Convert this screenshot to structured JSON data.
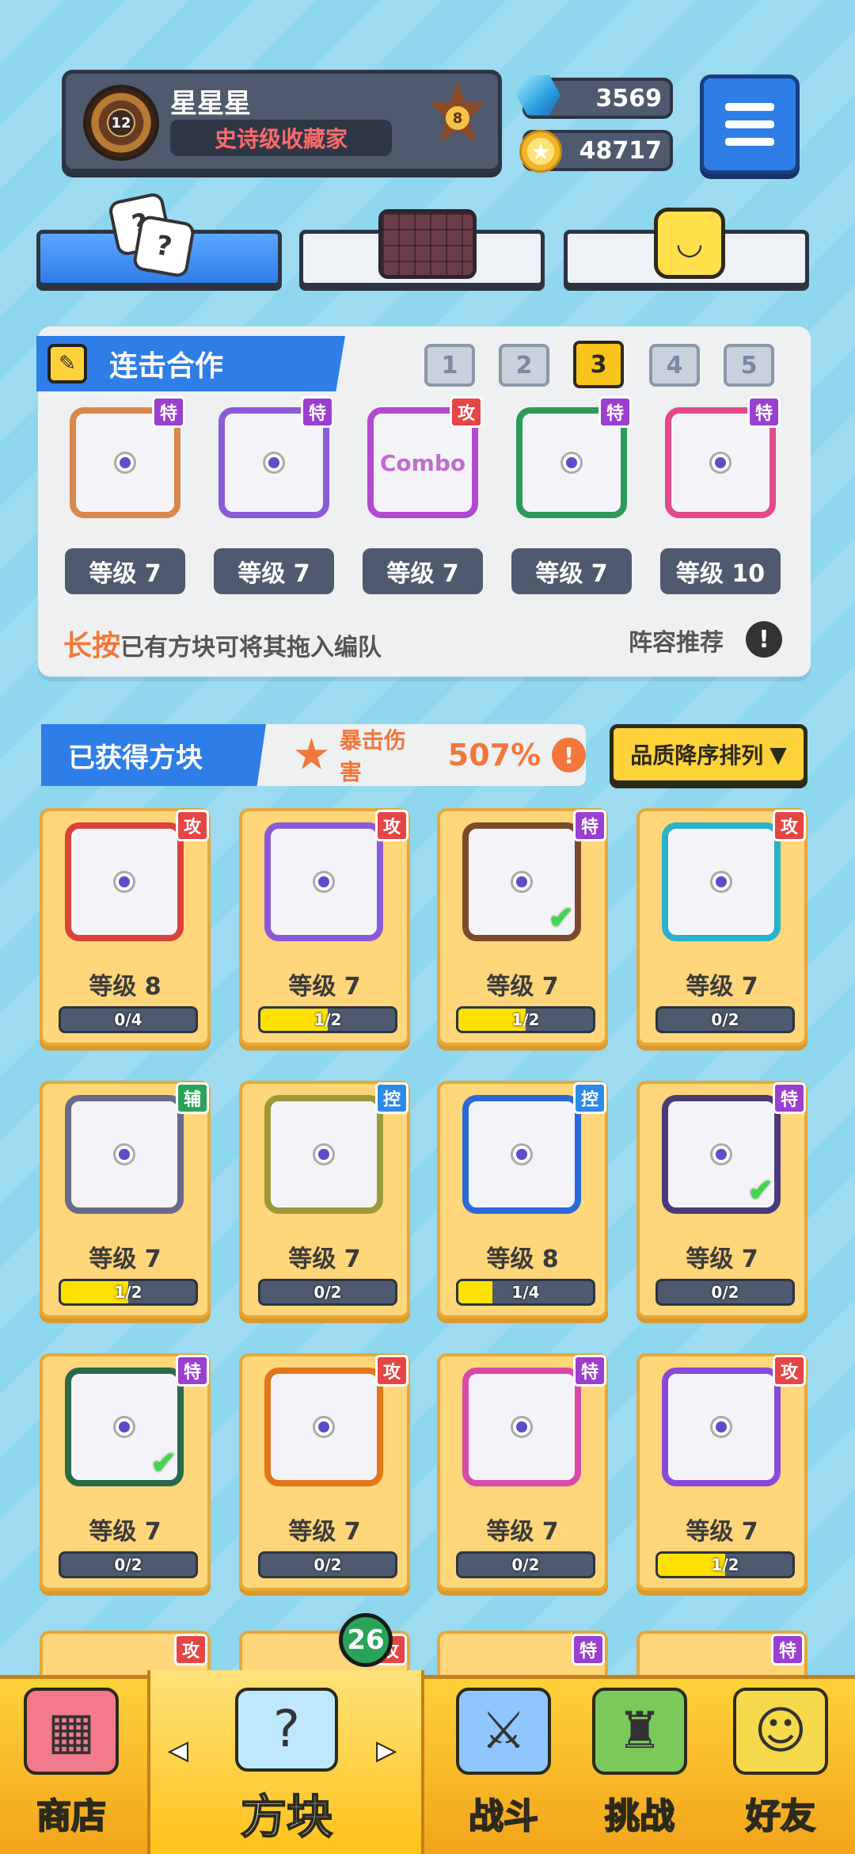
{
  "profile": {
    "name": "星星星",
    "title": "史诗级收藏家",
    "level": "12",
    "rank": "8"
  },
  "currency": {
    "gems": "3569",
    "coins": "48717"
  },
  "combo": {
    "title": "连击合作",
    "slots": [
      "1",
      "2",
      "3",
      "4",
      "5"
    ],
    "active_slot": "3",
    "blocks": [
      {
        "tag": "特",
        "level": "等级 7",
        "color": "#d9884a"
      },
      {
        "tag": "特",
        "level": "等级 7",
        "color": "#8a5ad8"
      },
      {
        "tag": "攻",
        "level": "等级 7",
        "color": "#b24ad0",
        "text": "Combo"
      },
      {
        "tag": "特",
        "level": "等级 7",
        "color": "#2c9a5a"
      },
      {
        "tag": "特",
        "level": "等级 10",
        "color": "#e24a8a"
      }
    ],
    "hint_highlight": "长按",
    "hint_text": "已有方块可将其拖入编队",
    "recommend": "阵容推荐",
    "recommend_icon": "!"
  },
  "owned": {
    "title": "已获得方块",
    "crit_label": "暴击伤害",
    "crit_value": "507%",
    "crit_icon": "!",
    "sort_label": "品质降序排列",
    "sort_arrow": "▼",
    "cards": [
      {
        "tag": "攻",
        "level": "等级 8",
        "progress": "0/4",
        "fill": 0.0,
        "color": "#d9433a",
        "check": ""
      },
      {
        "tag": "攻",
        "level": "等级 7",
        "progress": "1/2",
        "fill": 0.5,
        "color": "#8a5ad8",
        "check": ""
      },
      {
        "tag": "特",
        "level": "等级 7",
        "progress": "1/2",
        "fill": 0.5,
        "color": "#7a4a2a",
        "check": "✔"
      },
      {
        "tag": "攻",
        "level": "等级 7",
        "progress": "0/2",
        "fill": 0.0,
        "color": "#2ab2c8",
        "check": ""
      },
      {
        "tag": "辅",
        "level": "等级 7",
        "progress": "1/2",
        "fill": 0.5,
        "color": "#6a6a8a",
        "check": ""
      },
      {
        "tag": "控",
        "level": "等级 7",
        "progress": "0/2",
        "fill": 0.0,
        "color": "#9a9a3a",
        "check": ""
      },
      {
        "tag": "控",
        "level": "等级 8",
        "progress": "1/4",
        "fill": 0.25,
        "color": "#2a6ad8",
        "check": ""
      },
      {
        "tag": "特",
        "level": "等级 7",
        "progress": "0/2",
        "fill": 0.0,
        "color": "#4a3a7a",
        "check": "✔"
      },
      {
        "tag": "特",
        "level": "等级 7",
        "progress": "0/2",
        "fill": 0.0,
        "color": "#2a6a4a",
        "check": "✔"
      },
      {
        "tag": "攻",
        "level": "等级 7",
        "progress": "0/2",
        "fill": 0.0,
        "color": "#e2761a",
        "check": ""
      },
      {
        "tag": "特",
        "level": "等级 7",
        "progress": "0/2",
        "fill": 0.0,
        "color": "#d84aa8",
        "check": ""
      },
      {
        "tag": "攻",
        "level": "等级 7",
        "progress": "1/2",
        "fill": 0.5,
        "color": "#8a4ad8",
        "check": ""
      }
    ],
    "peek_tags": [
      "攻",
      "攻",
      "特",
      "特"
    ]
  },
  "nav": {
    "shop": "商店",
    "blocks": "方块",
    "battle": "战斗",
    "challenge": "挑战",
    "friends": "好友",
    "blocks_badge": "26",
    "arrow_left": "◀",
    "arrow_right": "▶"
  },
  "colors": {
    "accent": "#2f7ee8",
    "gold": "#ffd23a",
    "background": "#8fd6ef"
  }
}
